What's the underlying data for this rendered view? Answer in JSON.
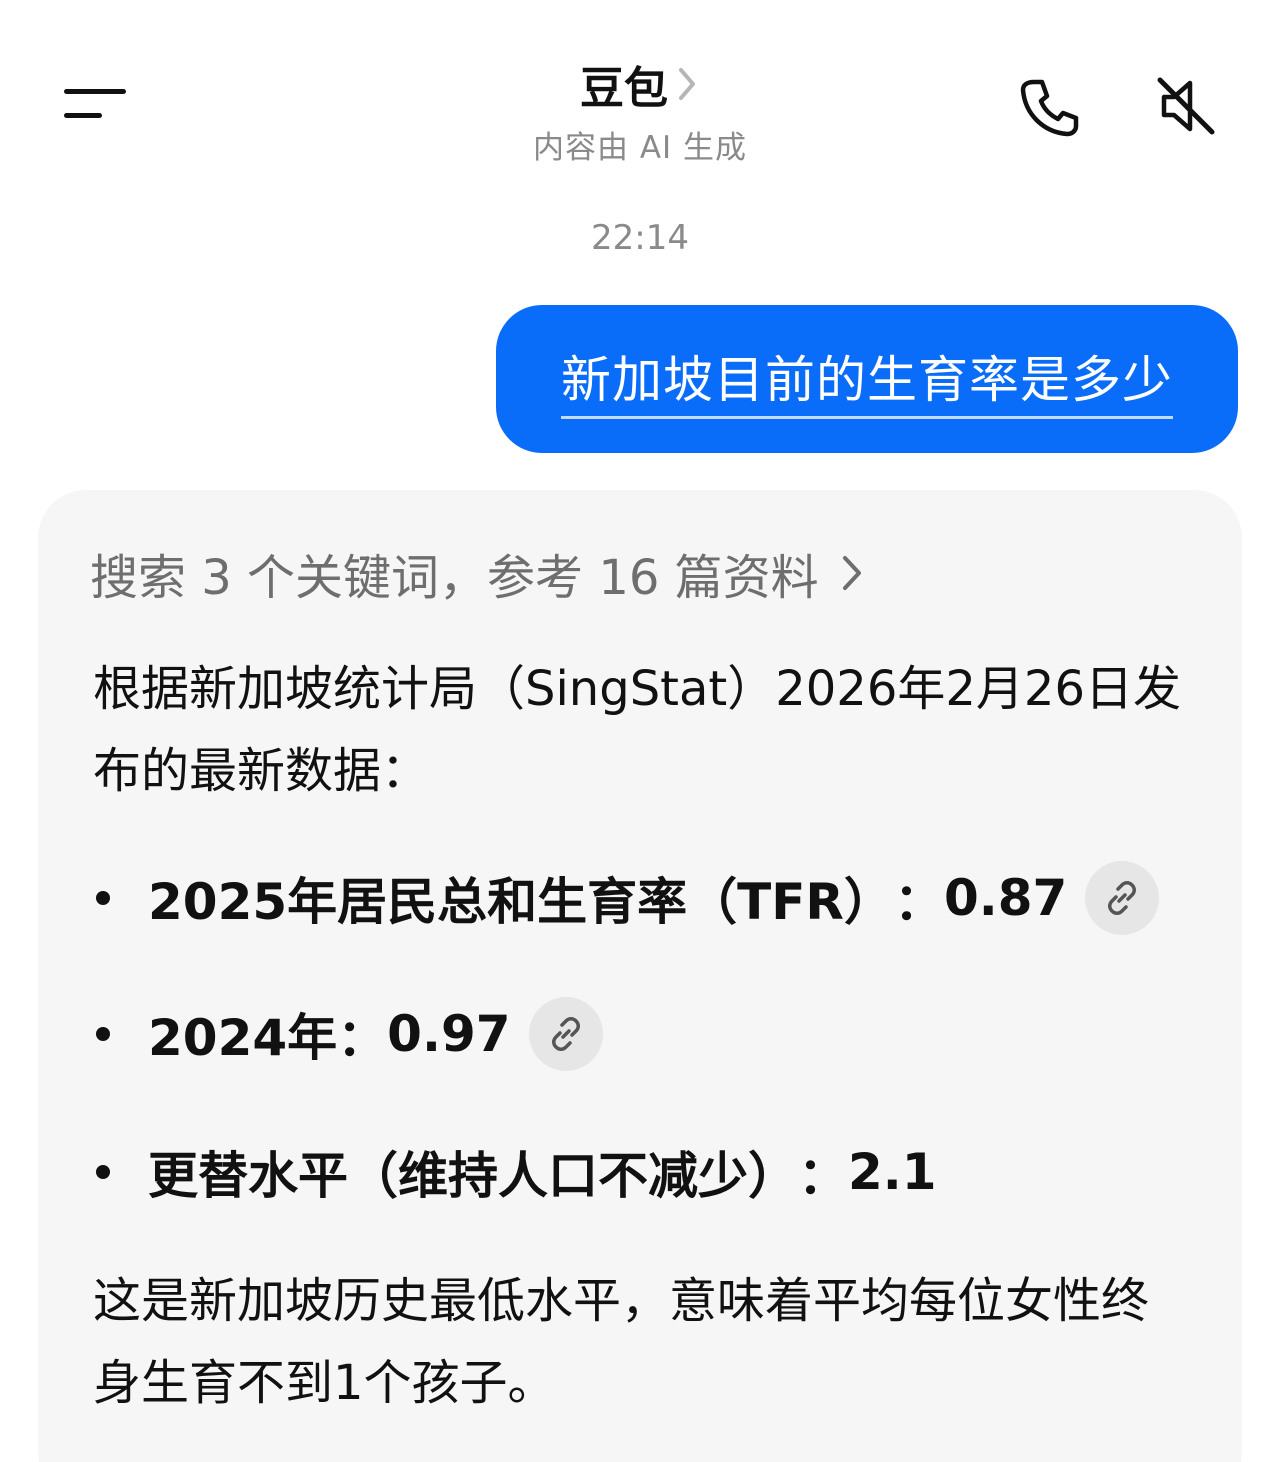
{
  "header": {
    "title": "豆包",
    "subtitle": "内容由 AI 生成",
    "menu_icon": "menu-icon",
    "phone_icon": "phone-icon",
    "mute_icon": "speaker-muted-icon"
  },
  "chat": {
    "timestamp": "22:14",
    "user_message": "新加坡目前的生育率是多少",
    "user_bubble_color": "#0a6dfa",
    "ai": {
      "search_summary": "搜索 3 个关键词，参考 16 篇资料",
      "intro": "根据新加坡统计局（SingStat）2026年2月26日发布的最新数据：",
      "bullets": [
        {
          "label": "2025年居民总和生育率（TFR）",
          "sep": "：",
          "value": "0.87",
          "has_link": true
        },
        {
          "label": "2024年",
          "sep": "：",
          "value": "0.97",
          "has_link": true
        },
        {
          "label": "更替水平（维持人口不减少）",
          "sep": "：",
          "value": "2.1",
          "has_link": false
        }
      ],
      "conclusion": "这是新加坡历史最低水平，意味着平均每位女性终身生育不到1个孩子。",
      "card_color": "#f6f6f6"
    }
  }
}
